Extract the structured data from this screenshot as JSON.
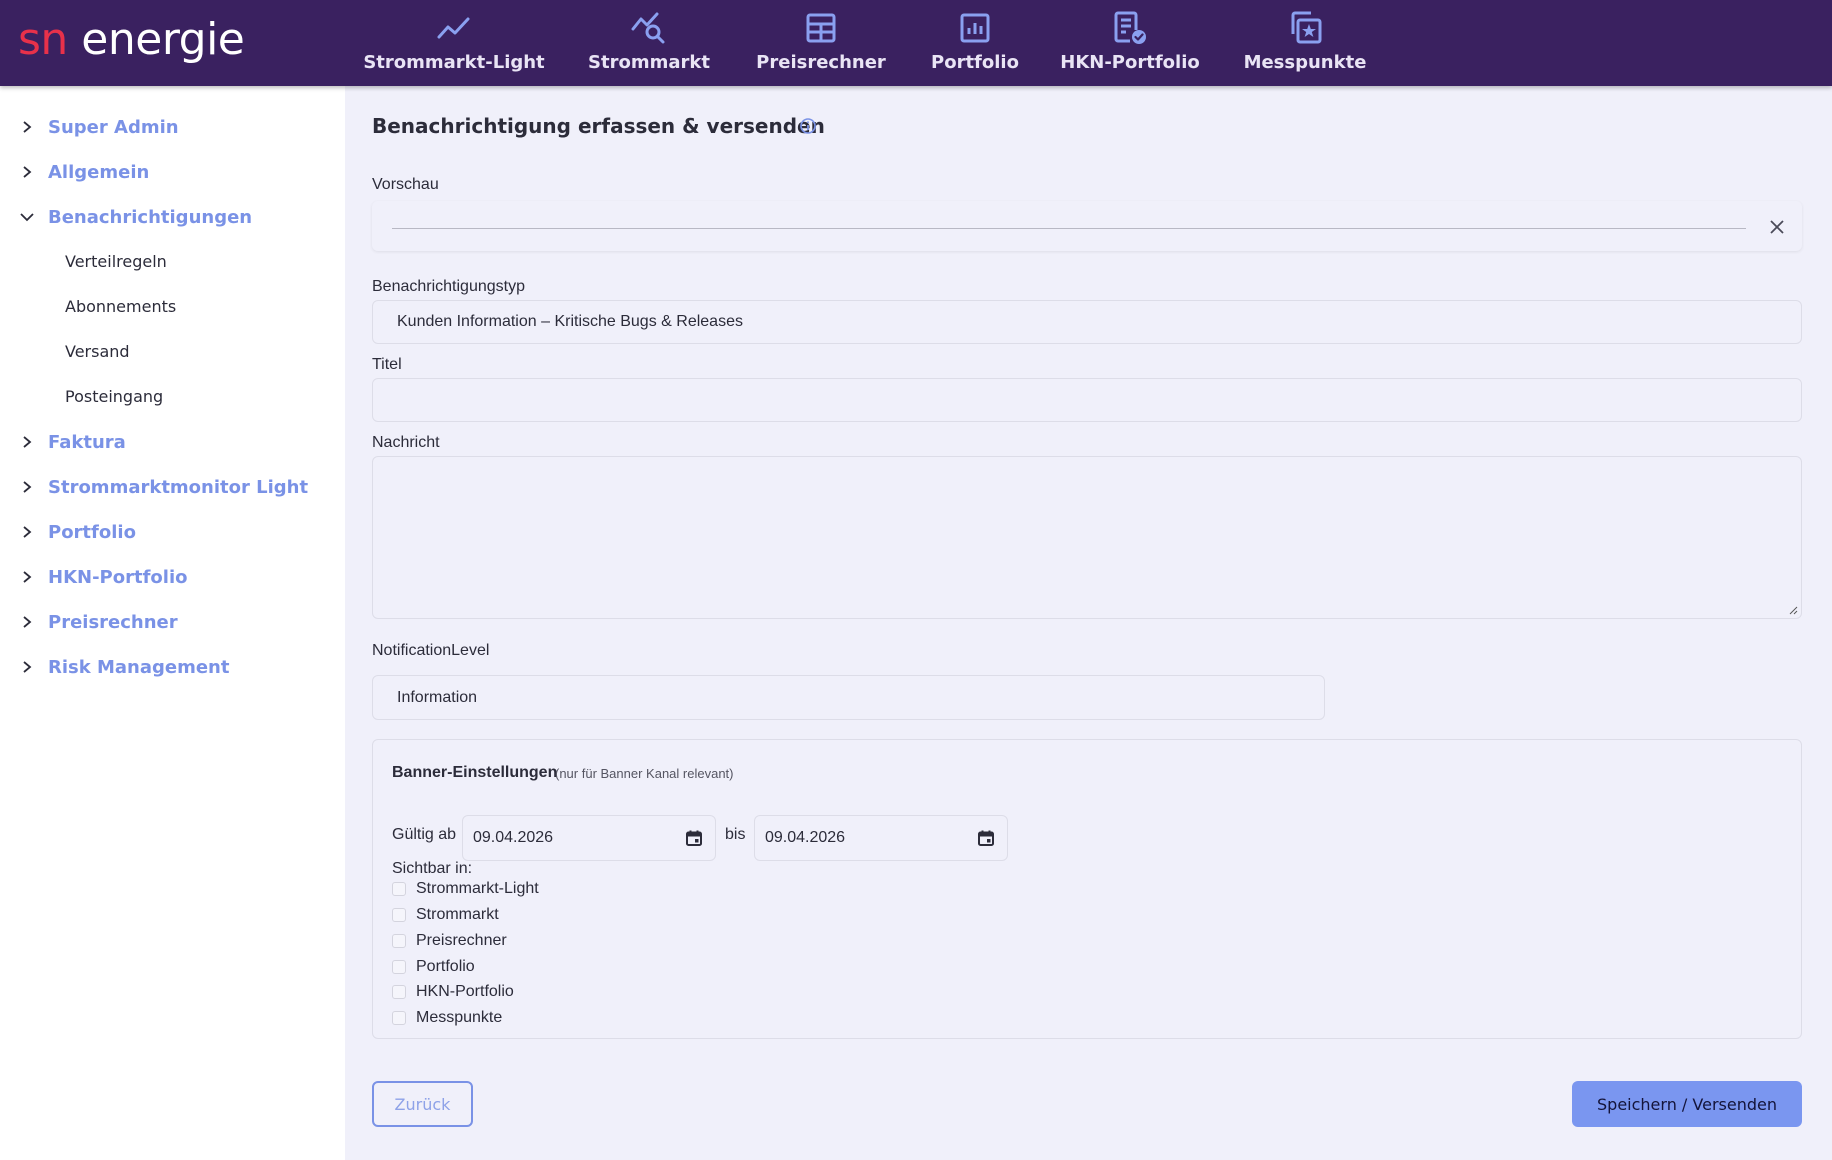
{
  "logo": {
    "part1": "sn",
    "part2": " energie"
  },
  "nav": [
    {
      "label": "Strommarkt-Light",
      "icon": "trend-line-icon"
    },
    {
      "label": "Strommarkt",
      "icon": "chart-search-icon"
    },
    {
      "label": "Preisrechner",
      "icon": "table-icon"
    },
    {
      "label": "Portfolio",
      "icon": "bar-chart-icon"
    },
    {
      "label": "HKN-Portfolio",
      "icon": "certificate-icon"
    },
    {
      "label": "Messpunkte",
      "icon": "star-box-icon"
    }
  ],
  "sidebar": {
    "items": [
      {
        "label": "Super Admin",
        "expanded": false
      },
      {
        "label": "Allgemein",
        "expanded": false
      },
      {
        "label": "Benachrichtigungen",
        "expanded": true
      },
      {
        "label": "Faktura",
        "expanded": false
      },
      {
        "label": "Strommarktmonitor Light",
        "expanded": false
      },
      {
        "label": "Portfolio",
        "expanded": false
      },
      {
        "label": "HKN-Portfolio",
        "expanded": false
      },
      {
        "label": "Preisrechner",
        "expanded": false
      },
      {
        "label": "Risk Management",
        "expanded": false
      }
    ],
    "subitems": [
      "Verteilregeln",
      "Abonnements",
      "Versand",
      "Posteingang"
    ]
  },
  "main": {
    "title": "Benachrichtigung erfassen & versenden",
    "preview_label": "Vorschau",
    "type_label": "Benachrichtigungstyp",
    "type_value": "Kunden Information – Kritische Bugs & Releases",
    "title_label": "Titel",
    "title_value": "",
    "message_label": "Nachricht",
    "message_value": "",
    "level_label": "NotificationLevel",
    "level_value": "Information"
  },
  "banner": {
    "title": "Banner-Einstellungen",
    "hint": "(nur für Banner Kanal relevant)",
    "valid_from_label": "Gültig ab",
    "valid_from": "09.04.2026",
    "to_label": "bis",
    "valid_to": "09.04.2026",
    "visible_label": "Sichtbar in:",
    "options": [
      "Strommarkt-Light",
      "Strommarkt",
      "Preisrechner",
      "Portfolio",
      "HKN-Portfolio",
      "Messpunkte"
    ]
  },
  "buttons": {
    "back": "Zurück",
    "save": "Speichern / Versenden"
  },
  "colors": {
    "header": "#3a2160",
    "accent": "#7a92e6",
    "logo_red": "#e8314a",
    "background": "#f0f0fa"
  }
}
